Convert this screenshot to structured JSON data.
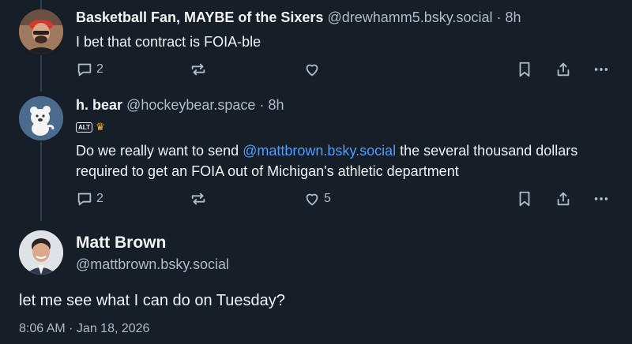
{
  "posts": [
    {
      "author_name": "Basketball Fan, MAYBE of the Sixers",
      "handle": "@drewhamm5.bsky.social",
      "time": "8h",
      "text": "I bet that contract is FOIA-ble",
      "reply_count": "2",
      "like_count": ""
    },
    {
      "author_name": "h. bear",
      "handle": "@hockeybear.space",
      "time": "8h",
      "badge_alt": "ALT",
      "badge_crown": "♛",
      "text_before": "Do we really want to send ",
      "mention": "@mattbrown.bsky.social",
      "text_after": " the several thousand dollars required to get an FOIA out of Michigan's athletic department",
      "reply_count": "2",
      "like_count": "5"
    }
  ],
  "main_post": {
    "author_name": "Matt Brown",
    "handle": "@mattbrown.bsky.social",
    "text": "let me see what I can do on Tuesday?",
    "timestamp": "8:06 AM · Jan 18, 2026"
  },
  "icons": [
    "reply-icon",
    "repost-icon",
    "like-icon",
    "bookmark-icon",
    "share-icon",
    "more-icon"
  ],
  "colors": {
    "background": "#161e27",
    "muted": "#aebbc9",
    "mention": "#4f9bff"
  }
}
